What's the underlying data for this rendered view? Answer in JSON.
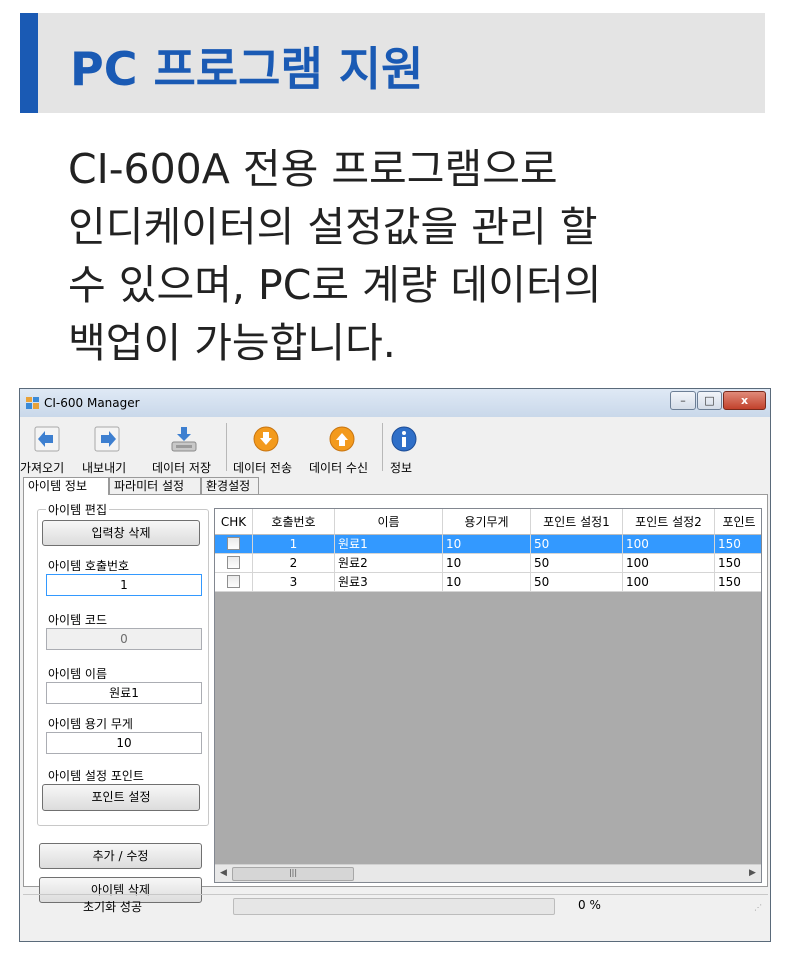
{
  "header": {
    "title": "PC 프로그램 지원",
    "accent_color": "#1a5ab4",
    "background_color": "#e4e4e4"
  },
  "description": {
    "lines": [
      "CI-600A 전용 프로그램으로",
      "인디케이터의 설정값을 관리 할",
      "수 있으며, PC로 계량 데이터의",
      "백업이 가능합니다."
    ]
  },
  "window": {
    "title": "CI-600 Manager",
    "controls": {
      "minimize": "–",
      "maximize": "□",
      "close": "x"
    },
    "toolbar": [
      {
        "label": "가져오기",
        "icon": "import-arrow-left-icon"
      },
      {
        "label": "내보내기",
        "icon": "export-arrow-right-icon"
      },
      {
        "label": "데이터 저장",
        "icon": "save-disk-icon"
      },
      {
        "label": "데이터 전송",
        "icon": "download-circle-icon"
      },
      {
        "label": "데이터 수신",
        "icon": "upload-circle-icon"
      },
      {
        "label": "정보",
        "icon": "info-icon"
      }
    ],
    "tabs": [
      "아이템 정보",
      "파라미터 설정",
      "환경설정"
    ],
    "active_tab": 0,
    "item_edit": {
      "group_title": "아이템 편집",
      "clear_button": "입력창 삭제",
      "call_number_label": "아이템 호출번호",
      "call_number_value": "1",
      "code_label": "아이템 코드",
      "code_value": "0",
      "name_label": "아이템 이름",
      "name_value": "원료1",
      "weight_label": "아이템 용기 무게",
      "weight_value": "10",
      "point_label": "아이템 설정 포인트",
      "point_button": "포인트 설정",
      "add_button": "추가 / 수정",
      "delete_button": "아이템 삭제"
    },
    "grid": {
      "columns": [
        "CHK",
        "호출번호",
        "이름",
        "용기무게",
        "포인트 설정1",
        "포인트 설정2",
        "포인트"
      ],
      "rows": [
        {
          "num": "1",
          "name": "원료1",
          "weight": "10",
          "p1": "50",
          "p2": "100",
          "p3": "150",
          "selected": true
        },
        {
          "num": "2",
          "name": "원료2",
          "weight": "10",
          "p1": "50",
          "p2": "100",
          "p3": "150",
          "selected": false
        },
        {
          "num": "3",
          "name": "원료3",
          "weight": "10",
          "p1": "50",
          "p2": "100",
          "p3": "150",
          "selected": false
        }
      ],
      "selection_color": "#3399ff"
    },
    "status": {
      "text": "초기화 성공",
      "progress_percent": 0,
      "progress_label": "0 %"
    }
  }
}
